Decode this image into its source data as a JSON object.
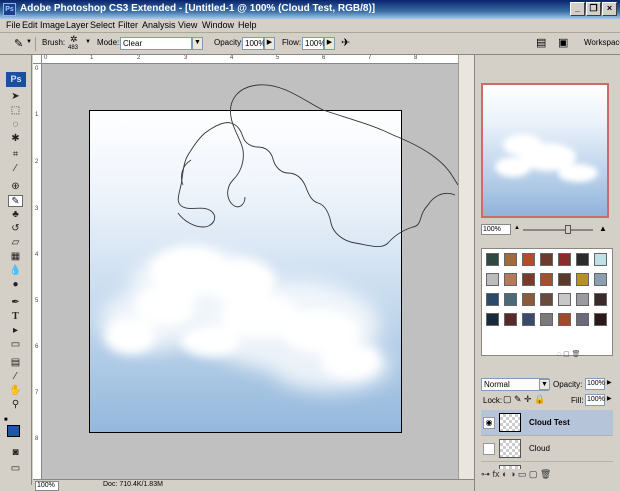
{
  "window": {
    "title": "Adobe Photoshop CS3 Extended - [Untitled-1 @ 100% (Cloud Test, RGB/8)]",
    "app_icon": "Ps",
    "controls": [
      "minimize",
      "restore",
      "close"
    ]
  },
  "menu": [
    "File",
    "Edit",
    "Image",
    "Layer",
    "Select",
    "Filter",
    "Analysis",
    "View",
    "Window",
    "Help"
  ],
  "options": {
    "brush_label": "Brush:",
    "brush_size": "483",
    "mode_label": "Mode:",
    "mode_value": "Clear",
    "opacity_label": "Opacity:",
    "opacity_value": "100%",
    "flow_label": "Flow:",
    "flow_value": "100%",
    "workspace_label": "Workspace"
  },
  "toolbox": {
    "logo": "Ps",
    "tools": [
      "move",
      "marquee",
      "lasso",
      "quick-select",
      "crop",
      "eyedropper",
      "healing",
      "brush",
      "stamp",
      "history-brush",
      "eraser",
      "gradient",
      "blur",
      "dodge",
      "pen",
      "type",
      "path-select",
      "shape",
      "notes",
      "eyedropper-2",
      "hand",
      "zoom",
      "foreground-color",
      "quick-mask",
      "screen-mode"
    ]
  },
  "rulers": {
    "horizontal": [
      "0",
      "1",
      "2",
      "3",
      "4",
      "5",
      "6",
      "7",
      "8"
    ],
    "vertical": [
      "0",
      "1",
      "2",
      "3",
      "4",
      "5",
      "6",
      "7",
      "8"
    ]
  },
  "status": {
    "zoom": "100%",
    "doc": "Doc: 710.4K/1.83M"
  },
  "navigator": {
    "zoom": "100%"
  },
  "styles": {
    "colors": [
      "#2e4a3e",
      "#a26b3b",
      "#b54a2c",
      "#6b3b2b",
      "#8b2b2b",
      "#2b2b2b",
      "#bfe0e6",
      "#bcbcbc",
      "#b57a5a",
      "#7a3a2a",
      "#a0522d",
      "#5a3a2a",
      "#b8902a",
      "#8aa0b0",
      "#2a4a6a",
      "#4a6a7a",
      "#8a5a3a",
      "#6a4a3a",
      "#c8c8c8",
      "#9a9aa0",
      "#3a2a2a",
      "#1a2a3a",
      "#5a2a2a",
      "#3a4a6a",
      "#7a7a7a",
      "#a04a2a",
      "#6a6a7a",
      "#2a1a1a"
    ]
  },
  "layers": {
    "blend_mode": "Normal",
    "opacity_label": "Opacity:",
    "opacity_value": "100%",
    "lock_label": "Lock:",
    "fill_label": "Fill:",
    "fill_value": "100%",
    "items": [
      {
        "name": "Cloud Test",
        "selected": true,
        "visible": true
      },
      {
        "name": "Cloud",
        "selected": false,
        "visible": false
      },
      {
        "name": "",
        "selected": false,
        "visible": false
      }
    ]
  }
}
